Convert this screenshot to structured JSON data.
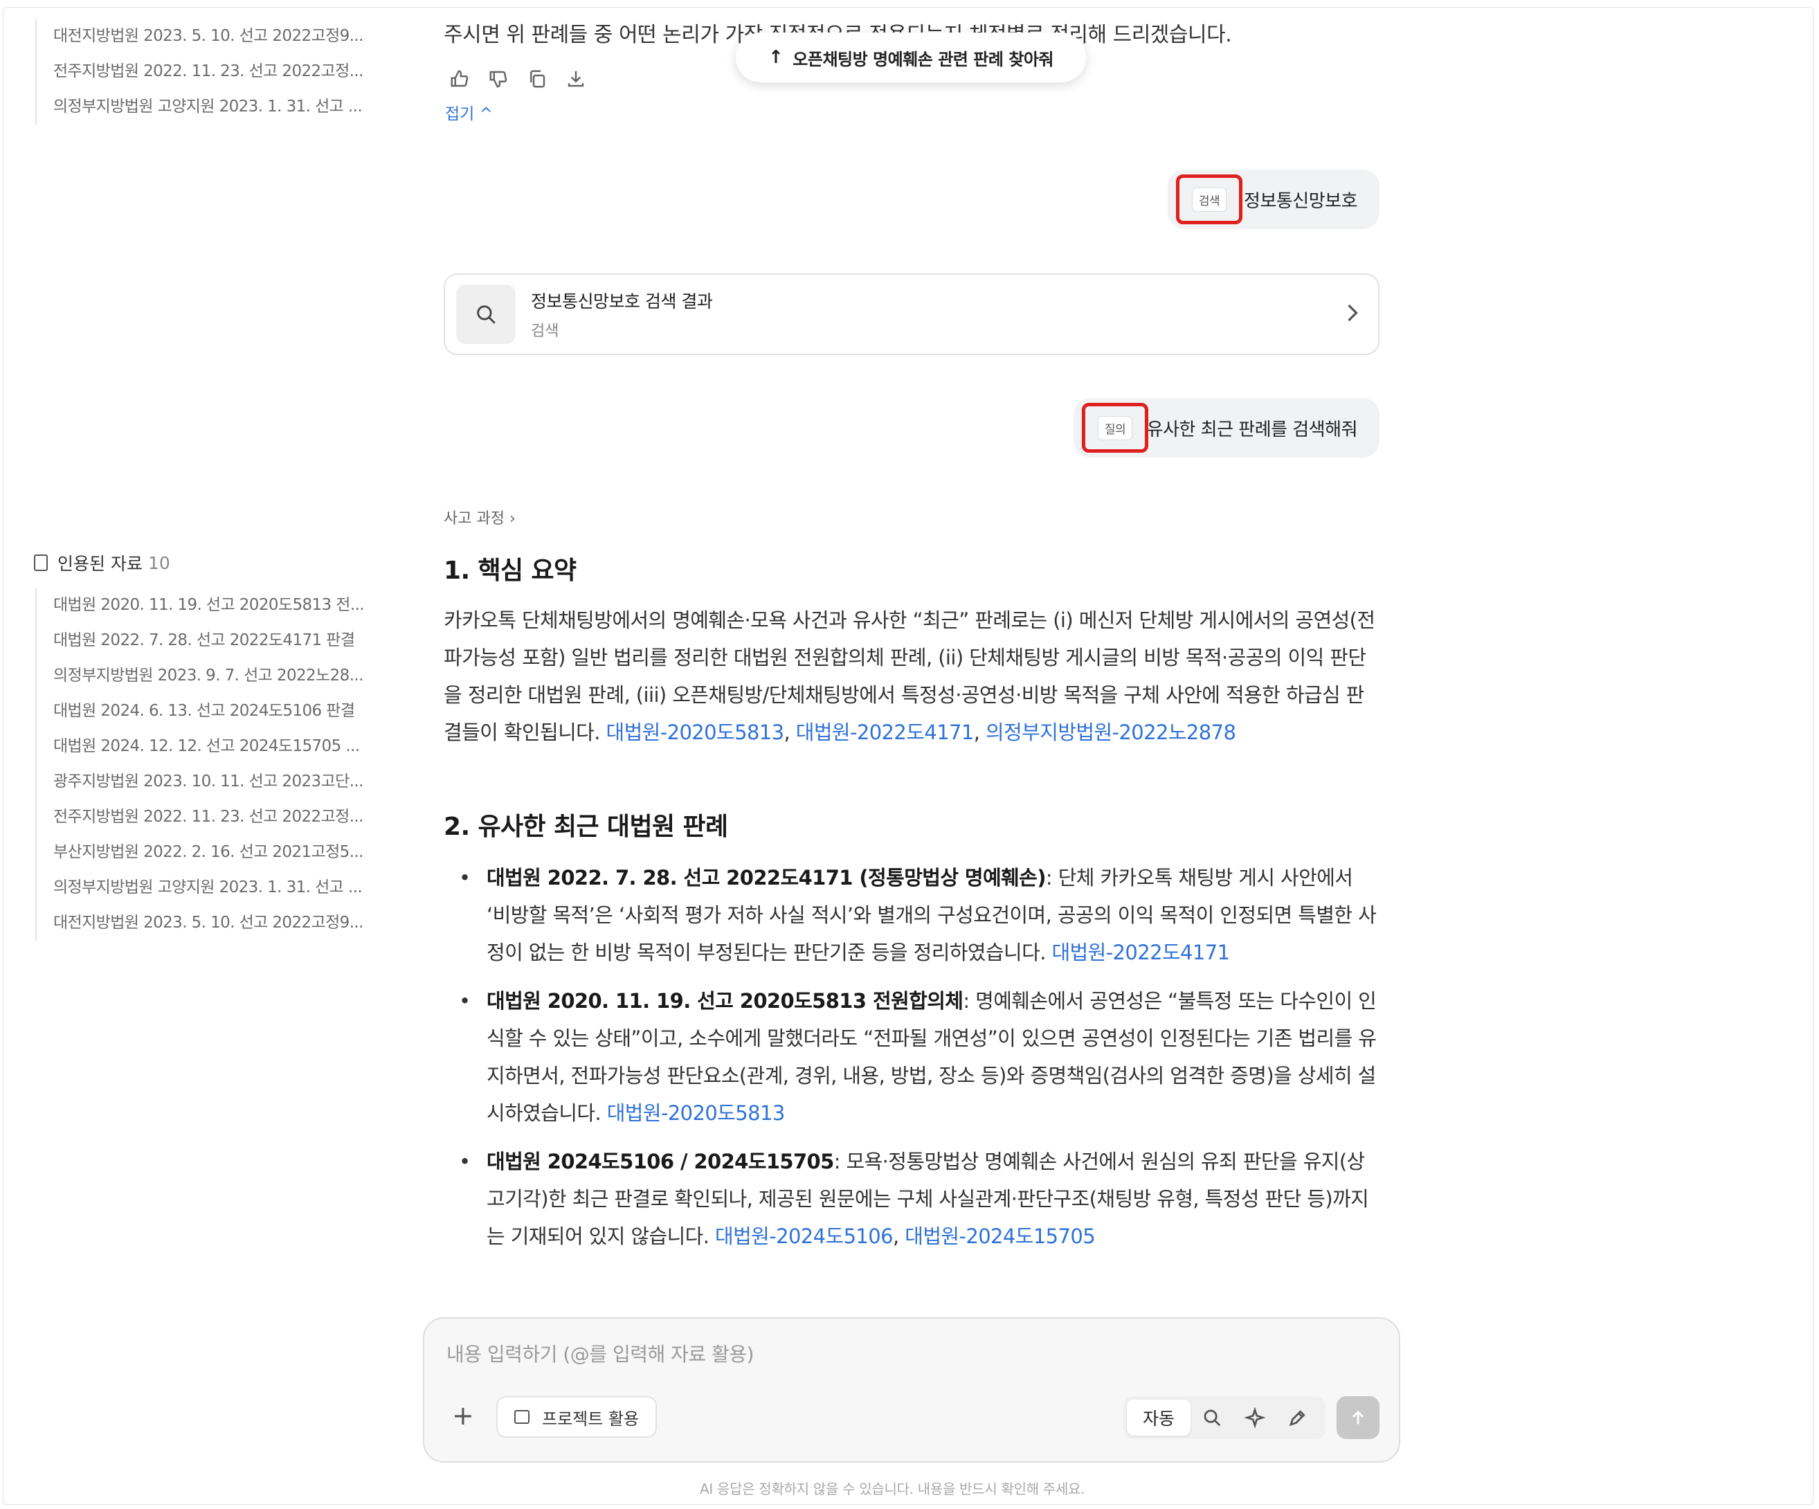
{
  "sidebar": {
    "top_items": [
      "대전지방법원 2023. 5. 10. 선고 2022고정9...",
      "전주지방법원 2022. 11. 23. 선고 2022고정...",
      "의정부지방법원 고양지원 2023. 1. 31. 선고 ..."
    ],
    "cited_label": "인용된 자료",
    "cited_count": "10",
    "cited_items": [
      "대법원 2020. 11. 19. 선고 2020도5813 전...",
      "대법원 2022. 7. 28. 선고 2022도4171 판결",
      "의정부지방법원 2023. 9. 7. 선고 2022노28...",
      "대법원 2024. 6. 13. 선고 2024도5106 판결",
      "대법원 2024. 12. 12. 선고 2024도15705 ...",
      "광주지방법원 2023. 10. 11. 선고 2023고단...",
      "전주지방법원 2022. 11. 23. 선고 2022고정...",
      "부산지방법원 2022. 2. 16. 선고 2021고정5...",
      "의정부지방법원 고양지원 2023. 1. 31. 선고 ...",
      "대전지방법원 2023. 5. 10. 선고 2022고정9..."
    ]
  },
  "main": {
    "intro": "주시면 위 판례들 중 어떤 논리가 가장 직접적으로 적용되는지 체적별로 정리해 드리겠습니다.",
    "collapse_label": "접기 ^",
    "floating_label": "오픈채팅방 명예훼손 관련 판례 찾아줘",
    "bubble1": {
      "tag": "검색",
      "text": "정보통신망보호"
    },
    "search_card": {
      "title": "정보통신망보호 검색 결과",
      "subtitle": "검색"
    },
    "bubble2": {
      "tag": "질의",
      "text": "유사한 최근 판례를 검색해줘"
    },
    "thinking_label": "사고 과정 ›",
    "section1": {
      "heading": "1. 핵심 요약",
      "text": "카카오톡 단체채팅방에서의 명예훼손·모욕 사건과 유사한 “최근” 판례로는 (i) 메신저 단체방 게시에서의 공연성(전파가능성 포함) 일반 법리를 정리한 대법원 전원합의체 판례, (ii) 단체채팅방 게시글의 비방 목적·공공의 이익 판단을 정리한 대법원 판례, (iii) 오픈채팅방/단체채팅방에서 특정성·공연성·비방 목적을 구체 사안에 적용한 하급심 판결들이 확인됩니다. ",
      "link1": "대법원-2020도5813",
      "link2": "대법원-2022도4171",
      "link3": "의정부지방법원-2022노2878"
    },
    "section2": {
      "heading": "2. 유사한 최근 대법원 판례",
      "bullets": [
        {
          "bold": "대법원 2022. 7. 28. 선고 2022도4171 (정통망법상 명예훼손)",
          "text": ": 단체 카카오톡 채팅방 게시 사안에서 ‘비방할 목적’은 ‘사회적 평가 저하 사실 적시’와 별개의 구성요건이며, 공공의 이익 목적이 인정되면 특별한 사정이 없는 한 비방 목적이 부정된다는 판단기준 등을 정리하였습니다. ",
          "links": [
            "대법원-2022도4171"
          ]
        },
        {
          "bold": "대법원 2020. 11. 19. 선고 2020도5813 전원합의체",
          "text": ": 명예훼손에서 공연성은 “불특정 또는 다수인이 인식할 수 있는 상태”이고, 소수에게 말했더라도 “전파될 개연성”이 있으면 공연성이 인정된다는 기존 법리를 유지하면서, 전파가능성 판단요소(관계, 경위, 내용, 방법, 장소 등)와 증명책임(검사의 엄격한 증명)을 상세히 설시하였습니다. ",
          "links": [
            "대법원-2020도5813"
          ]
        },
        {
          "bold": "대법원 2024도5106 / 2024도15705",
          "text": ": 모욕·정통망법상 명예훼손 사건에서 원심의 유죄 판단을 유지(상고기각)한 최근 판결로 확인되나, 제공된 원문에는 구체 사실관계·판단구조(채팅방 유형, 특정성 판단 등)까지는 기재되어 있지 않습니다. ",
          "links": [
            "대법원-2024도5106",
            "대법원-2024도15705"
          ]
        }
      ]
    }
  },
  "composer": {
    "placeholder": "내용 입력하기 (@를 입력해 자료 활용)",
    "project_label": "프로젝트 활용",
    "mode_label": "자동"
  },
  "disclaimer": "AI 응답은 정확하지 않을 수 있습니다. 내용을 반드시 확인해 주세요.",
  "colors": {
    "link": "#2f72d8",
    "highlight": "#e0201e"
  }
}
